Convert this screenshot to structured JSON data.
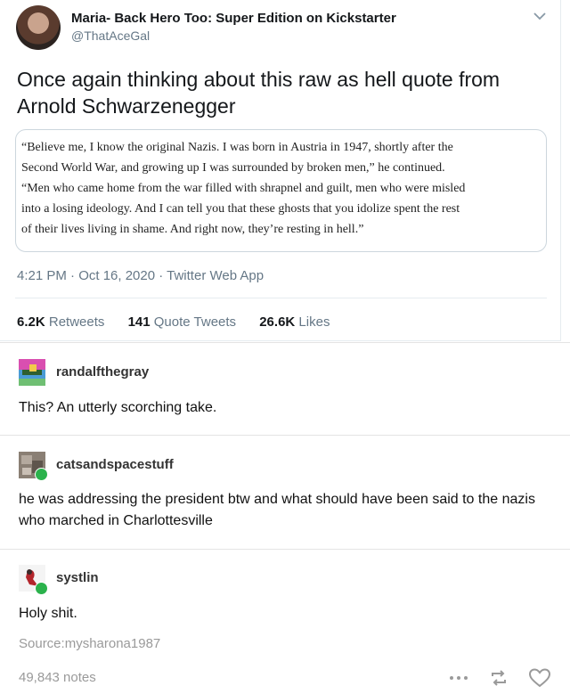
{
  "tweet": {
    "display_name": "Maria- Back Hero Too: Super Edition on Kickstarter",
    "handle": "@ThatAceGal",
    "text": "Once again thinking about this raw as hell quote from Arnold Schwarzenegger",
    "quote_lines": [
      "“Believe me, I know the original Nazis. I was born in Austria in 1947, shortly after the",
      "Second World War, and growing up I was surrounded by broken men,” he continued.",
      "“Men who came home from the war filled with shrapnel and guilt, men who were misled",
      "into a losing ideology. And I can tell you that these ghosts that you idolize spent the rest",
      "of their lives living in shame. And right now, they’re resting in hell.”"
    ],
    "meta": "4:21 PM · Oct 16, 2020 · Twitter Web App",
    "stats": {
      "retweets_count": "6.2K",
      "retweets_label": "Retweets",
      "quotes_count": "141",
      "quotes_label": "Quote Tweets",
      "likes_count": "26.6K",
      "likes_label": "Likes"
    }
  },
  "replies": [
    {
      "username": "randalfthegray",
      "text": "This? An utterly scorching take.",
      "reblog": false
    },
    {
      "username": "catsandspacestuff",
      "text": "he was addressing the president btw and what should have been said to the nazis who marched in Charlottesville",
      "reblog": true
    },
    {
      "username": "systlin",
      "text": "Holy shit.",
      "reblog": true
    }
  ],
  "footer": {
    "source": "Source:mysharona1987",
    "notes": "49,843 notes"
  },
  "icons": [
    "chevron-down-icon",
    "more-icon",
    "reblog-icon",
    "heart-icon"
  ],
  "colors": {
    "reblog_badge": "#2bb24c",
    "muted_text": "#657786"
  }
}
